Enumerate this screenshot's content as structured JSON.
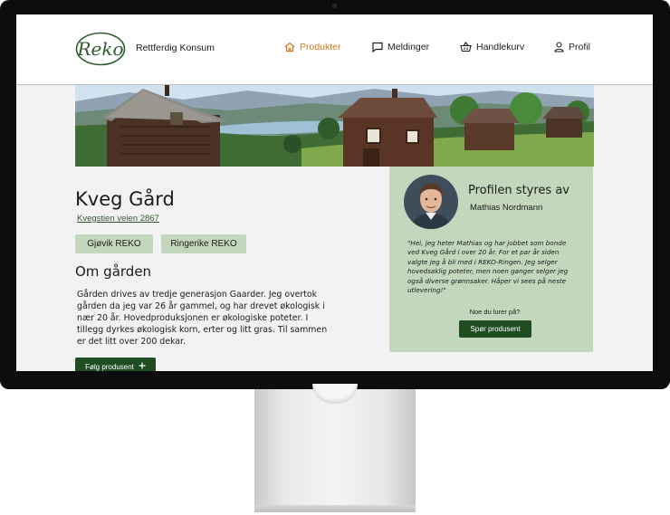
{
  "app": {
    "logo_text": "Reko",
    "brand_name": "Rettferdig Konsum"
  },
  "nav": {
    "items": [
      {
        "label": "Produkter",
        "icon": "home-icon",
        "active": true
      },
      {
        "label": "Meldinger",
        "icon": "message-icon",
        "active": false
      },
      {
        "label": "Handlekurv",
        "icon": "basket-icon",
        "active": false
      },
      {
        "label": "Profil",
        "icon": "user-icon",
        "active": false
      }
    ]
  },
  "farm": {
    "name": "Kveg Gård",
    "address": "Kvegstien veien 2867",
    "rings": [
      "Gjøvik REKO",
      "Ringerike REKO"
    ],
    "about_title": "Om gården",
    "about_text": "Gården drives av tredje generasjon Gaarder. Jeg overtok gården da jeg var 26 år gammel, og har drevet økologisk i nær 20 år. Hovedproduksjonen er økologiske poteter. I tillegg dyrkes økologisk korn, erter og litt gras. Til sammen er det litt over 200 dekar.",
    "follow_label": "Følg produsent",
    "follow_icon": "plus-icon"
  },
  "profile": {
    "title": "Profilen styres av",
    "name": "Mathias Nordmann",
    "quote": "\"Hei, jeg heter Mathias og har jobbet som bonde ved Kveg Gård i over 20 år. For et par år siden valgte jeg å bli med i REKO-Ringen. Jeg selger hovedsaklig poteter, men noen ganger selger jeg også diverse grønnsaker. Håper vi sees på neste utlevering!\"",
    "question": "Noe du lurer på?",
    "ask_label": "Spør produsent"
  },
  "colors": {
    "accent": "#d07a1e",
    "primary_button": "#1f4d21",
    "card_green": "#c3d7bd",
    "page_bg": "#f2f2f2"
  }
}
